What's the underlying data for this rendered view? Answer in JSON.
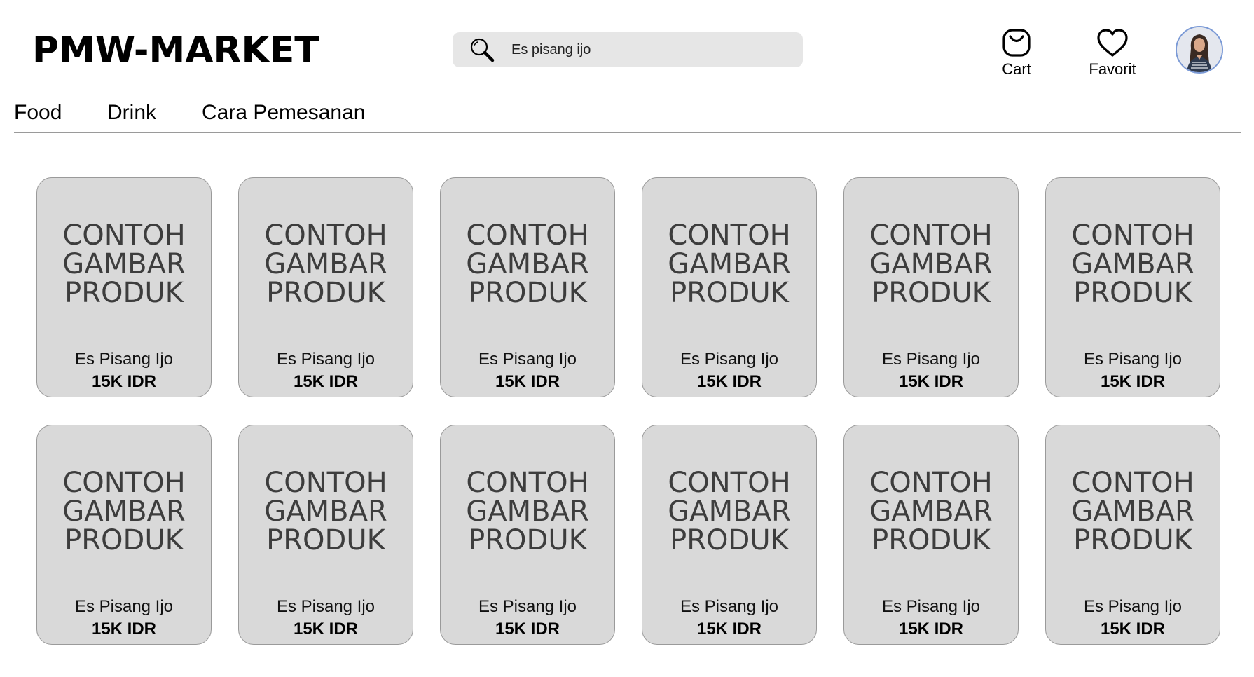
{
  "header": {
    "logo": "PMW-MARKET",
    "search": {
      "value": "Es pisang ijo",
      "icon": "search-icon"
    },
    "cart_label": "Cart",
    "favorite_label": "Favorit",
    "avatar": "user-avatar"
  },
  "nav": {
    "items": [
      {
        "label": "Food"
      },
      {
        "label": "Drink"
      },
      {
        "label": "Cara Pemesanan"
      }
    ]
  },
  "products": [
    {
      "image_text": "CONTOH\nGAMBAR\nPRODUK",
      "name": "Es Pisang Ijo",
      "price": "15K IDR"
    },
    {
      "image_text": "CONTOH\nGAMBAR\nPRODUK",
      "name": "Es Pisang Ijo",
      "price": "15K IDR"
    },
    {
      "image_text": "CONTOH\nGAMBAR\nPRODUK",
      "name": "Es Pisang Ijo",
      "price": "15K IDR"
    },
    {
      "image_text": "CONTOH\nGAMBAR\nPRODUK",
      "name": "Es Pisang Ijo",
      "price": "15K IDR"
    },
    {
      "image_text": "CONTOH\nGAMBAR\nPRODUK",
      "name": "Es Pisang Ijo",
      "price": "15K IDR"
    },
    {
      "image_text": "CONTOH\nGAMBAR\nPRODUK",
      "name": "Es Pisang Ijo",
      "price": "15K IDR"
    },
    {
      "image_text": "CONTOH\nGAMBAR\nPRODUK",
      "name": "Es Pisang Ijo",
      "price": "15K IDR"
    },
    {
      "image_text": "CONTOH\nGAMBAR\nPRODUK",
      "name": "Es Pisang Ijo",
      "price": "15K IDR"
    },
    {
      "image_text": "CONTOH\nGAMBAR\nPRODUK",
      "name": "Es Pisang Ijo",
      "price": "15K IDR"
    },
    {
      "image_text": "CONTOH\nGAMBAR\nPRODUK",
      "name": "Es Pisang Ijo",
      "price": "15K IDR"
    },
    {
      "image_text": "CONTOH\nGAMBAR\nPRODUK",
      "name": "Es Pisang Ijo",
      "price": "15K IDR"
    },
    {
      "image_text": "CONTOH\nGAMBAR\nPRODUK",
      "name": "Es Pisang Ijo",
      "price": "15K IDR"
    }
  ],
  "colors": {
    "card_bg": "#d9d9d9",
    "search_bg": "#e6e6e6",
    "avatar_ring": "#7b9ad6"
  }
}
